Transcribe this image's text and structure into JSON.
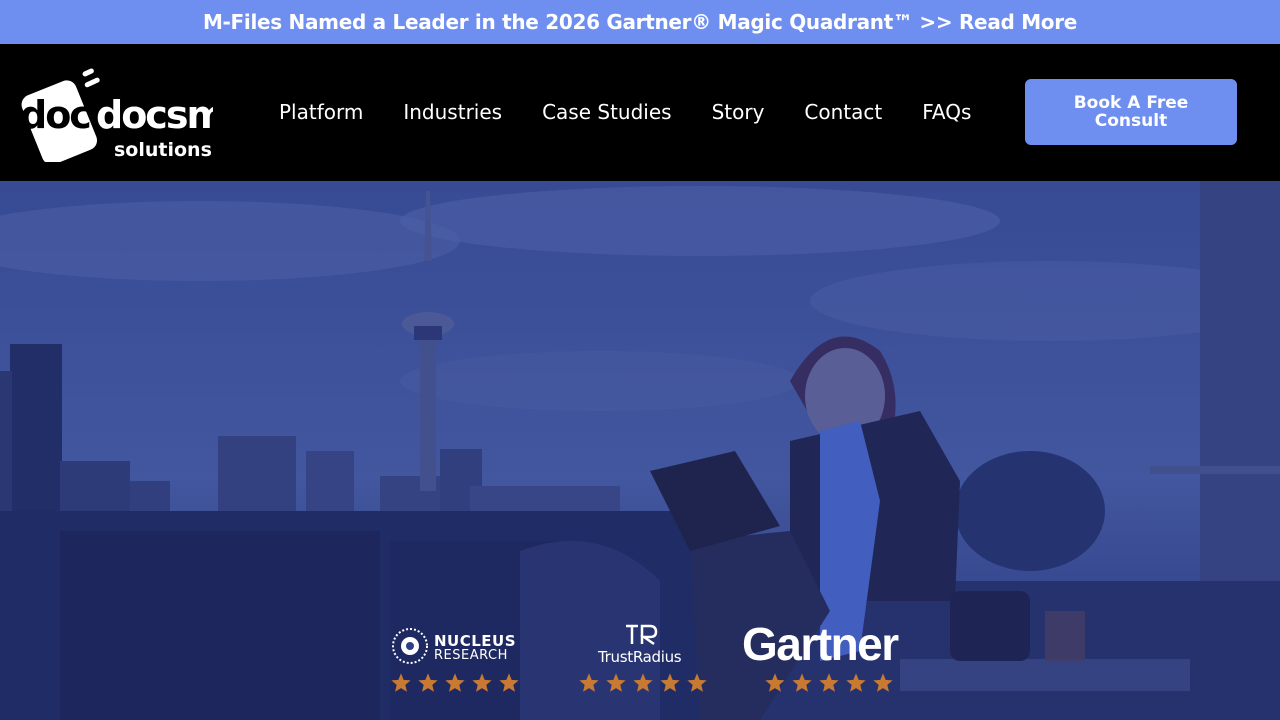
{
  "announcement": {
    "text": "M-Files Named a Leader in the 2026 Gartner® Magic Quadrant™ >> Read More"
  },
  "logo": {
    "primary": "docsmart",
    "secondary": "solutions"
  },
  "nav": {
    "items": [
      {
        "label": "Platform"
      },
      {
        "label": "Industries"
      },
      {
        "label": "Case Studies"
      },
      {
        "label": "Story"
      },
      {
        "label": "Contact"
      },
      {
        "label": "FAQs"
      }
    ]
  },
  "cta": {
    "label": "Book A Free Consult"
  },
  "ratings": [
    {
      "name": "NUCLEUS",
      "sub": "RESEARCH",
      "stars": 5
    },
    {
      "name": "TrustRadius",
      "stars": 5
    },
    {
      "name": "Gartner",
      "stars": 5
    }
  ],
  "colors": {
    "accent": "#6e8ff0",
    "header_bg": "#000000",
    "hero_overlay": "#2e3f86",
    "star": "#c97a32"
  }
}
